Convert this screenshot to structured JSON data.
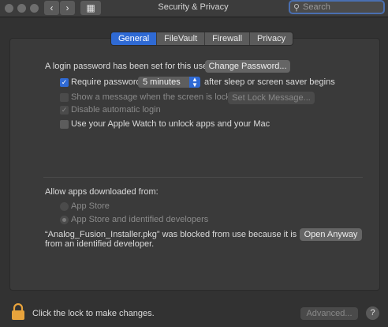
{
  "window": {
    "title": "Security & Privacy",
    "back_glyph": "‹",
    "forward_glyph": "›",
    "grid_glyph": "▦"
  },
  "search": {
    "placeholder": "Search"
  },
  "tabs": [
    {
      "label": "General",
      "active": true
    },
    {
      "label": "FileVault",
      "active": false
    },
    {
      "label": "Firewall",
      "active": false
    },
    {
      "label": "Privacy",
      "active": false
    }
  ],
  "general": {
    "login_password_text": "A login password has been set for this user",
    "change_password_button": "Change Password...",
    "require_password_label": "Require password",
    "require_password_checked": true,
    "require_password_interval": "5 minutes",
    "after_sleep_text": "after sleep or screen saver begins",
    "show_message_label": "Show a message when the screen is locked",
    "set_lock_message_button": "Set Lock Message...",
    "disable_auto_login_label": "Disable automatic login",
    "apple_watch_label": "Use your Apple Watch to unlock apps and your Mac",
    "apple_watch_checked": false,
    "allow_apps_heading": "Allow apps downloaded from:",
    "option_app_store": "App Store",
    "option_app_store_identified": "App Store and identified developers",
    "blocked_text_line1": "“Analog_Fusion_Installer.pkg” was blocked from use because it is not",
    "blocked_text_line2": "from an identified developer.",
    "open_anyway_button": "Open Anyway"
  },
  "footer": {
    "lock_text": "Click the lock to make changes.",
    "advanced_button": "Advanced...",
    "help_label": "?"
  },
  "colors": {
    "accent": "#2f6ad4",
    "background": "#323232",
    "panel": "#3a3a3a",
    "lock": "#e8a33c"
  }
}
